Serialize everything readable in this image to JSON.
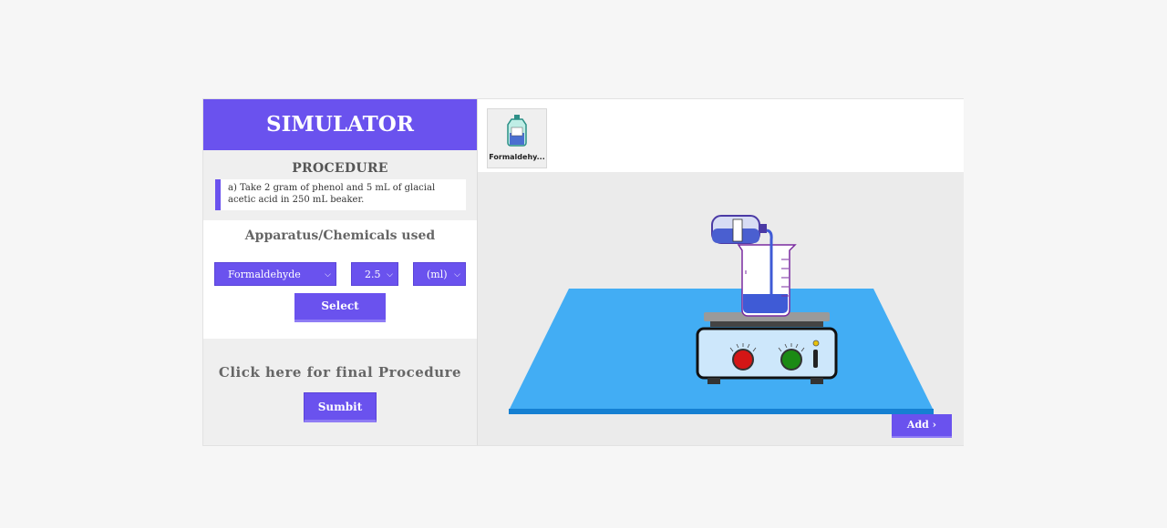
{
  "header": {
    "title": "SIMULATOR"
  },
  "procedure": {
    "title": "PROCEDURE",
    "step": "a) Take 2 gram of phenol and 5 mL of glacial acetic acid in 250 mL beaker."
  },
  "apparatus": {
    "title": "Apparatus/Chemicals used",
    "chemical_select": "Formaldehyde",
    "amount_select": "2.5",
    "unit_select": "(ml)",
    "select_label": "Select"
  },
  "final": {
    "title": "Click here for final Procedure",
    "submit_label": "Sumbit"
  },
  "toolbar": {
    "items": [
      {
        "label": "Formaldehy...",
        "icon": "bottle-icon"
      }
    ]
  },
  "scene": {
    "add_label": "Add",
    "hotplate_knob_left_color": "#d41616",
    "hotplate_knob_right_color": "#1b8a14",
    "mat_color": "#42adf4",
    "liquid_color": "#3f5bd6"
  },
  "colors": {
    "accent": "#6a52ee"
  }
}
